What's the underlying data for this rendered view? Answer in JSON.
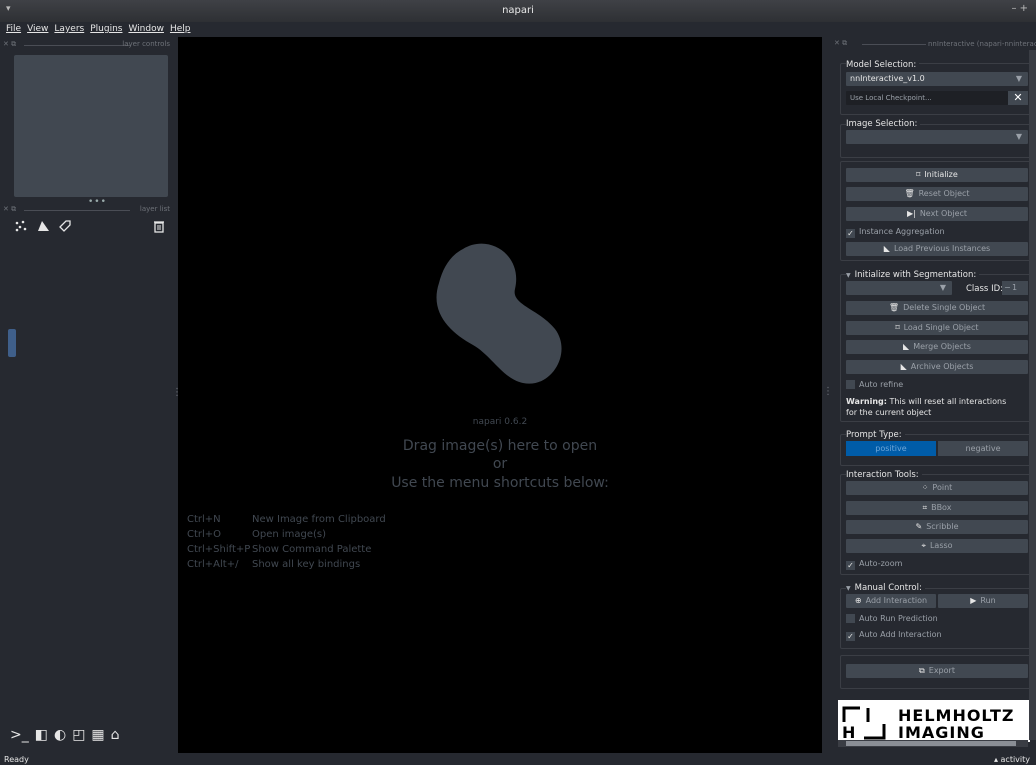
{
  "window": {
    "title": "napari",
    "menu_glyph": "▾",
    "controls": "– +"
  },
  "menu": [
    "File",
    "View",
    "Layers",
    "Plugins",
    "Window",
    "Help"
  ],
  "left_panel": {
    "layer_controls_label": "layer controls",
    "layer_list_label": "layer list",
    "dots": "•••"
  },
  "canvas": {
    "version": "napari 0.6.2",
    "drag_text": "Drag image(s) here to open",
    "or_text": "or",
    "menu_text": "Use the menu shortcuts below:",
    "shortcuts": [
      {
        "key": "Ctrl+N",
        "label": "New Image from Clipboard"
      },
      {
        "key": "Ctrl+O",
        "label": "Open image(s)"
      },
      {
        "key": "Ctrl+Shift+P",
        "label": "Show Command Palette"
      },
      {
        "key": "Ctrl+Alt+/",
        "label": "Show all key bindings"
      }
    ]
  },
  "plugin": {
    "dock_title": "nnInteractive (napari-nninteractive",
    "model_selection_label": "Model Selection:",
    "model_value": "nnInteractive_v1.0",
    "checkpoint_placeholder": "Use Local Checkpoint...",
    "image_selection_label": "Image Selection:",
    "initialize": "Initialize",
    "reset_object": "Reset Object",
    "next_object": "Next Object",
    "instance_aggregation": "Instance Aggregation",
    "load_previous": "Load Previous Instances",
    "init_seg_label": "Initialize with Segmentation:",
    "class_id_label": "Class ID:",
    "class_id_value": "1",
    "delete_single": "Delete Single Object",
    "load_single": "Load Single Object",
    "merge_objects": "Merge Objects",
    "archive_objects": "Archive Objects",
    "auto_refine": "Auto refine",
    "warning_bold": "Warning:",
    "warning_text": " This will reset all interactions",
    "warning_text2": "for the current object",
    "prompt_type_label": "Prompt Type:",
    "positive": "positive",
    "negative": "negative",
    "interaction_tools_label": "Interaction Tools:",
    "point": "Point",
    "bbox": "BBox",
    "scribble": "Scribble",
    "lasso": "Lasso",
    "auto_zoom": "Auto-zoom",
    "manual_control_label": "Manual Control:",
    "add_interaction": "Add Interaction",
    "run": "Run",
    "auto_run": "Auto Run Prediction",
    "auto_add": "Auto Add Interaction",
    "export": "Export",
    "logo_line1": "HELMHOLTZ",
    "logo_line2": "IMAGING"
  },
  "status": {
    "left": "Ready",
    "right": "▴ activity"
  },
  "colors": {
    "accent": "#005ca8",
    "panel": "#262930",
    "widget": "#414851"
  }
}
